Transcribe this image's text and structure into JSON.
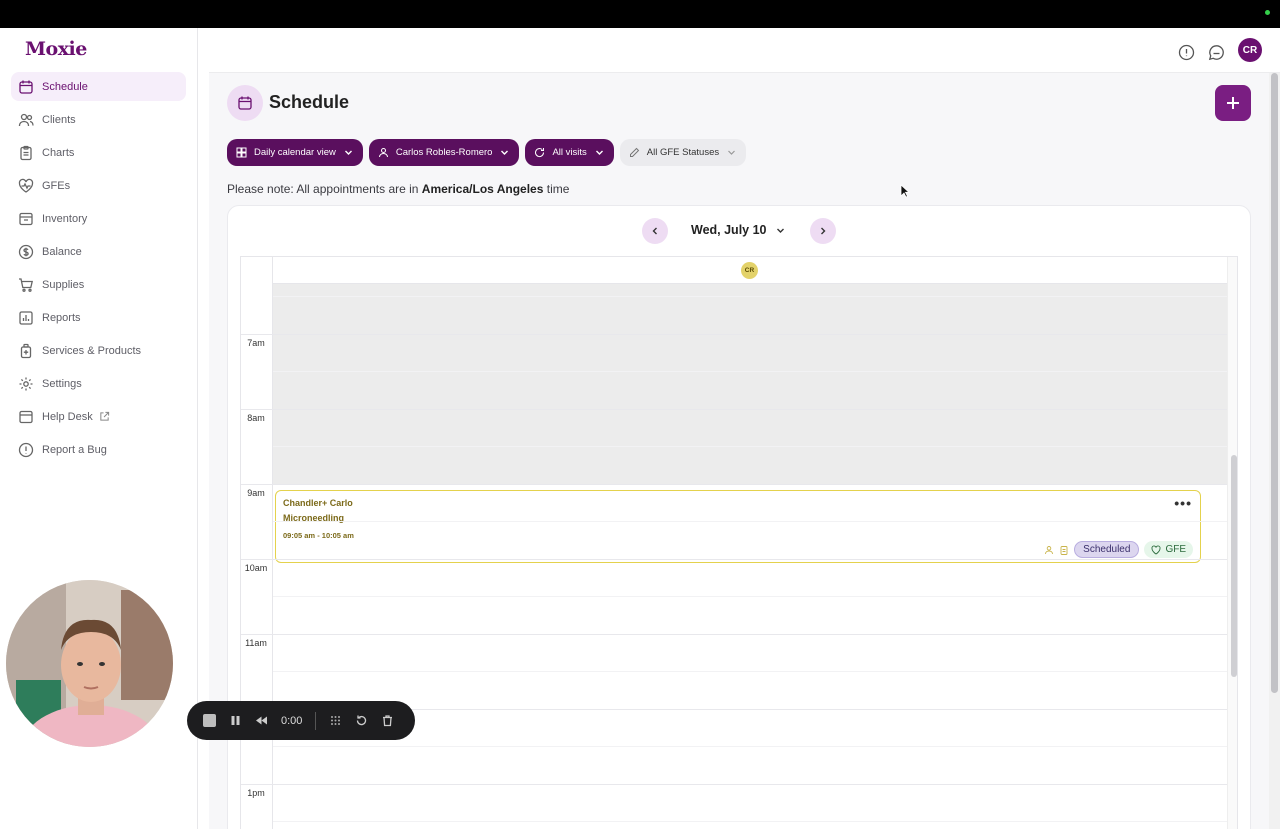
{
  "app": {
    "logo": "Moxie"
  },
  "sidebar": {
    "items": [
      {
        "label": "Schedule",
        "icon": "calendar-icon",
        "active": true
      },
      {
        "label": "Clients",
        "icon": "users-icon"
      },
      {
        "label": "Charts",
        "icon": "clipboard-icon"
      },
      {
        "label": "GFEs",
        "icon": "heart-pulse-icon"
      },
      {
        "label": "Inventory",
        "icon": "box-icon"
      },
      {
        "label": "Balance",
        "icon": "dollar-icon"
      },
      {
        "label": "Supplies",
        "icon": "cart-icon"
      },
      {
        "label": "Reports",
        "icon": "bar-chart-icon"
      },
      {
        "label": "Services & Products",
        "icon": "bottle-icon"
      },
      {
        "label": "Settings",
        "icon": "gear-icon"
      },
      {
        "label": "Help Desk",
        "icon": "chat-icon",
        "external": true
      },
      {
        "label": "Report a Bug",
        "icon": "alert-circle-icon"
      }
    ]
  },
  "header": {
    "avatar_initials": "CR"
  },
  "page": {
    "title": "Schedule",
    "filters": {
      "view": "Daily calendar view",
      "provider": "Carlos Robles-Romero",
      "visits": "All visits",
      "gfe_status": "All GFE Statuses"
    },
    "note_prefix": "Please note: All appointments are in ",
    "note_tz": "America/Los Angeles",
    "note_suffix": " time"
  },
  "calendar": {
    "date_label": "Wed, July 10",
    "column_avatar": "CR",
    "hours": [
      "7am",
      "8am",
      "9am",
      "10am",
      "11am",
      "1pm"
    ],
    "appointment": {
      "client": "Chandler+ Carlo",
      "service": "Microneedling",
      "time": "09:05 am - 10:05 am",
      "status": "Scheduled",
      "gfe": "GFE"
    }
  },
  "recorder": {
    "elapsed": "0:00"
  },
  "colors": {
    "brand": "#6a1070",
    "accent": "#7a1e82",
    "appointment_border": "#e4d24d"
  }
}
